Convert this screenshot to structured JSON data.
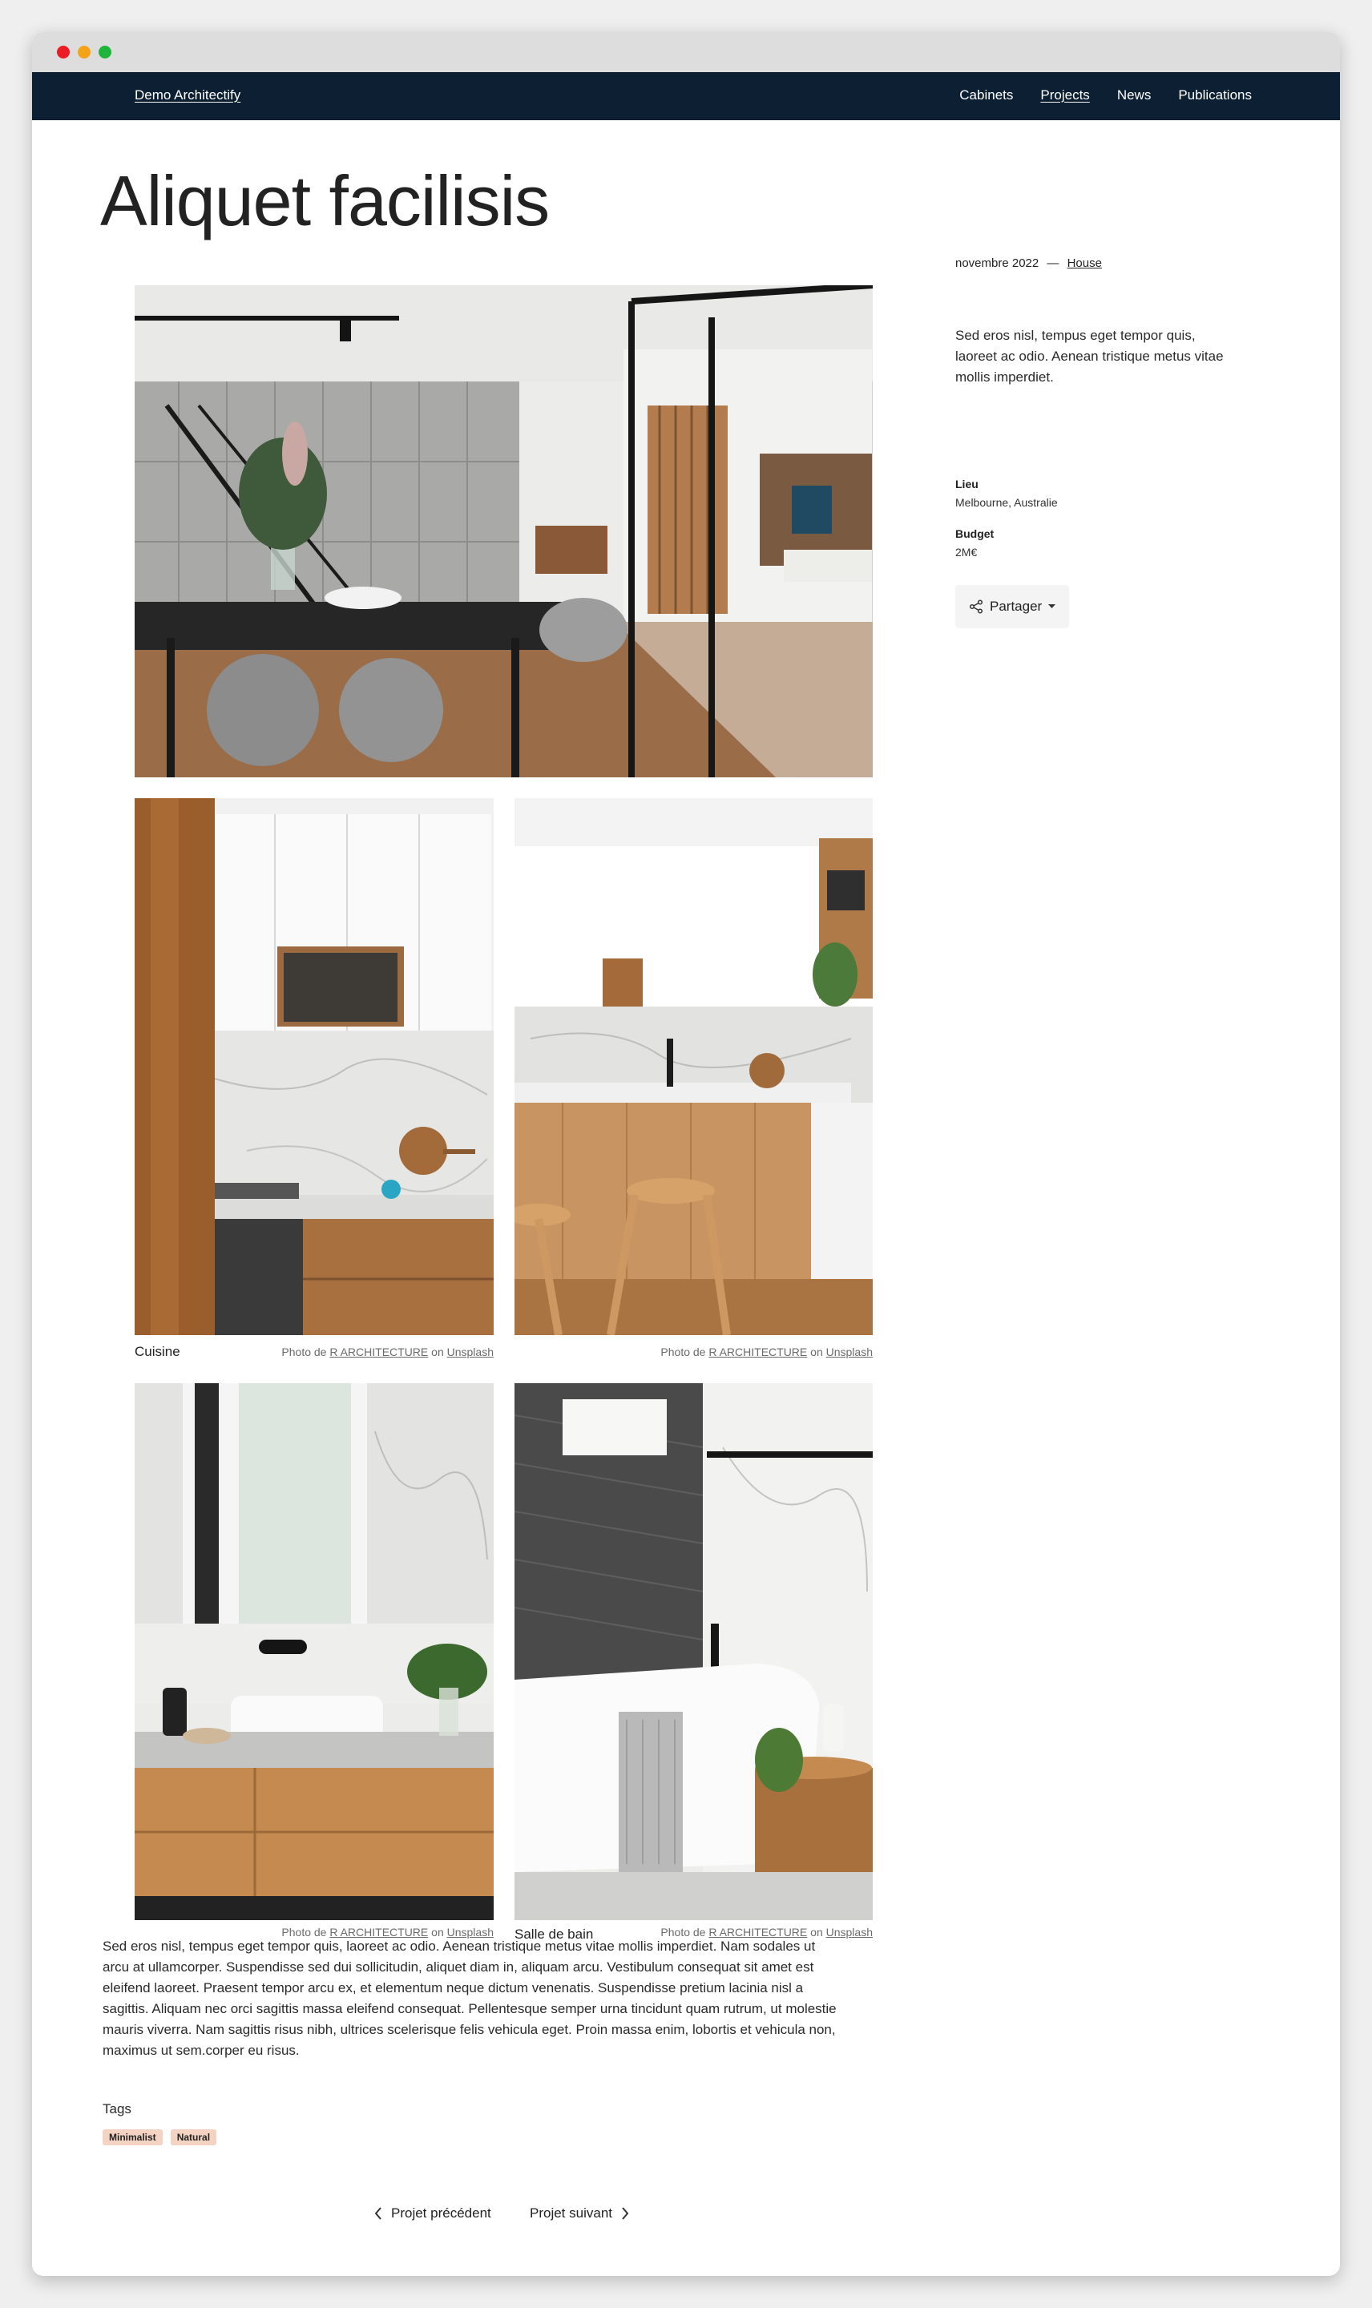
{
  "window": {
    "controls": [
      "close",
      "minimize",
      "maximize"
    ]
  },
  "navbar": {
    "brand": "Demo Architectify",
    "links": [
      {
        "label": "Cabinets",
        "active": false
      },
      {
        "label": "Projects",
        "active": true
      },
      {
        "label": "News",
        "active": false
      },
      {
        "label": "Publications",
        "active": false
      }
    ]
  },
  "page": {
    "title": "Aliquet facilisis"
  },
  "gallery": {
    "photos": [
      {
        "subject": "dining room with staircase",
        "caption": "",
        "credit_prefix": "",
        "author": "",
        "on": "",
        "source": ""
      },
      {
        "subject": "kitchen cabinets",
        "caption": "Cuisine",
        "credit_prefix": "Photo de",
        "author": "R ARCHITECTURE",
        "on": "on",
        "source": "Unsplash"
      },
      {
        "subject": "kitchen counter with stools",
        "caption": "",
        "credit_prefix": "Photo de",
        "author": "R ARCHITECTURE",
        "on": "on",
        "source": "Unsplash"
      },
      {
        "subject": "bathroom vanity",
        "caption": "",
        "credit_prefix": "Photo de",
        "author": "R ARCHITECTURE",
        "on": "on",
        "source": "Unsplash"
      },
      {
        "subject": "bathtub",
        "caption": "Salle de bain",
        "credit_prefix": "Photo de",
        "author": "R ARCHITECTURE",
        "on": "on",
        "source": "Unsplash"
      }
    ]
  },
  "body_text": "Sed eros nisl, tempus eget tempor quis, laoreet ac odio. Aenean tristique metus vitae mollis imperdiet. Nam sodales ut arcu at ullamcorper. Suspendisse sed dui sollicitudin, aliquet diam in, aliquam arcu. Vestibulum consequat sit amet est eleifend laoreet. Praesent tempor arcu ex, et elementum neque dictum venenatis. Suspendisse pretium lacinia nisl a sagittis. Aliquam nec orci sagittis massa eleifend consequat. Pellentesque semper urna tincidunt quam rutrum, ut molestie mauris viverra. Nam sagittis risus nibh, ultrices scelerisque felis vehicula eget. Proin massa enim, lobortis et vehicula non, maximus ut sem.corper eu risus.",
  "tags": {
    "label": "Tags",
    "items": [
      "Minimalist",
      "Natural"
    ]
  },
  "pager": {
    "previous": "Projet précédent",
    "next": "Projet suivant"
  },
  "sidebar": {
    "date": "novembre 2022",
    "separator": "—",
    "category": "House",
    "description": "Sed eros nisl, tempus eget tempor quis, laoreet ac odio. Aenean tristique metus vitae mollis imperdiet.",
    "location_label": "Lieu",
    "location_value": "Melbourne, Australie",
    "budget_label": "Budget",
    "budget_value": "2M€",
    "share_label": "Partager"
  },
  "icons": [
    "share-icon",
    "caret-down-icon",
    "chevron-left-icon",
    "chevron-right-icon"
  ]
}
